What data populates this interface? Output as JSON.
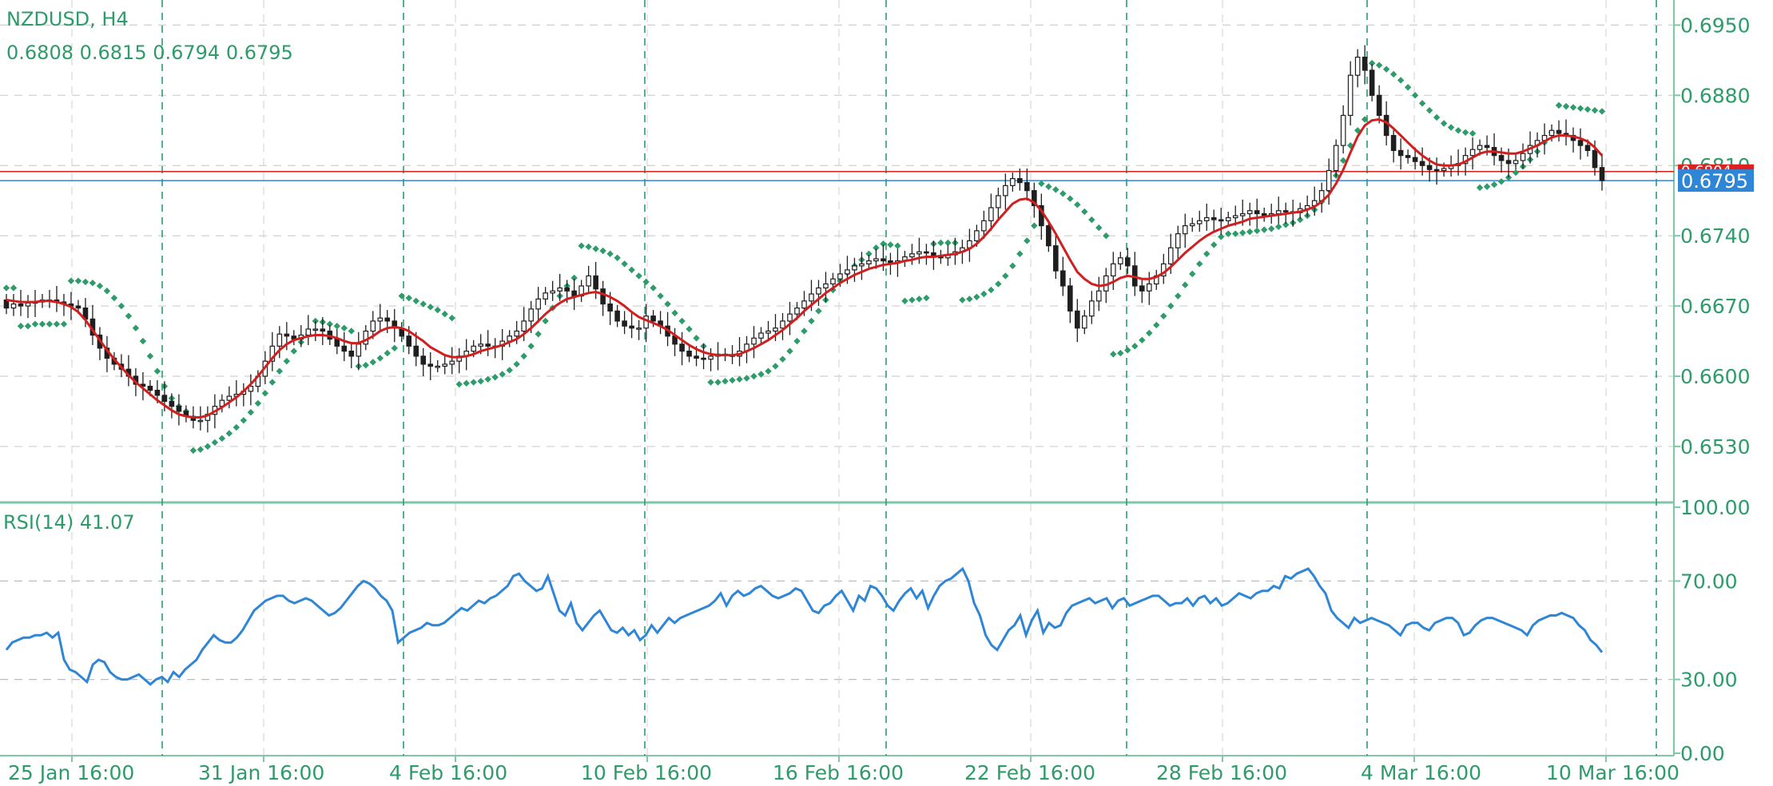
{
  "header": {
    "symbol": "NZDUSD, H4",
    "ohlc": "0.6808 0.6815 0.6794 0.6795",
    "rsi": "RSI(14) 41.07"
  },
  "colors": {
    "accent": "#2e9b6a",
    "candle": "#1f1f1f",
    "ma": "#d11f1f",
    "rsi": "#2f86d6",
    "sar": "#2e9b6a",
    "bid_line": "#2f86d6",
    "ask_line": "#d11f1f"
  },
  "chart_data": [
    {
      "type": "candlestick",
      "title": "NZDUSD, H4",
      "ylim": [
        0.6475,
        0.6975
      ],
      "y_ticks": [
        "0.6950",
        "0.6880",
        "0.6810",
        "0.6740",
        "0.6670",
        "0.6600",
        "0.6530"
      ],
      "x_ticks": [
        "25 Jan 16:00",
        "31 Jan 16:00",
        "4 Feb 16:00",
        "10 Feb 16:00",
        "16 Feb 16:00",
        "22 Feb 16:00",
        "28 Feb 16:00",
        "4 Mar 16:00",
        "10 Mar 16:00"
      ],
      "current_price": "0.6795",
      "ask_price_label": "0.6804",
      "grid": true,
      "close_series": [
        0.6668,
        0.6672,
        0.667,
        0.6673,
        0.6674,
        0.6676,
        0.6676,
        0.6674,
        0.6672,
        0.667,
        0.6668,
        0.6657,
        0.6641,
        0.6628,
        0.6618,
        0.6612,
        0.6607,
        0.66,
        0.6592,
        0.659,
        0.6586,
        0.6581,
        0.6575,
        0.657,
        0.6565,
        0.656,
        0.6556,
        0.6556,
        0.6562,
        0.657,
        0.6576,
        0.658,
        0.6582,
        0.6585,
        0.659,
        0.66,
        0.6615,
        0.663,
        0.6642,
        0.664,
        0.6637,
        0.6641,
        0.6647,
        0.6647,
        0.6645,
        0.6637,
        0.663,
        0.6625,
        0.662,
        0.6632,
        0.6645,
        0.6655,
        0.6658,
        0.6655,
        0.6648,
        0.664,
        0.663,
        0.662,
        0.6612,
        0.661,
        0.661,
        0.6612,
        0.6615,
        0.662,
        0.6625,
        0.663,
        0.6632,
        0.663,
        0.663,
        0.6635,
        0.664,
        0.6645,
        0.6655,
        0.6667,
        0.6677,
        0.6683,
        0.6685,
        0.6688,
        0.6685,
        0.668,
        0.669,
        0.67,
        0.6687,
        0.6672,
        0.6665,
        0.6655,
        0.665,
        0.6648,
        0.6648,
        0.666,
        0.6655,
        0.665,
        0.664,
        0.6632,
        0.6625,
        0.662,
        0.6618,
        0.6617,
        0.662,
        0.6622,
        0.6621,
        0.662,
        0.6625,
        0.6632,
        0.6638,
        0.6643,
        0.6645,
        0.6648,
        0.6655,
        0.6662,
        0.6668,
        0.6675,
        0.6682,
        0.6688,
        0.6692,
        0.6697,
        0.6702,
        0.6706,
        0.671,
        0.6712,
        0.6715,
        0.6717,
        0.6715,
        0.6713,
        0.6715,
        0.6719,
        0.6722,
        0.6724,
        0.6723,
        0.672,
        0.6718,
        0.6721,
        0.6724,
        0.6728,
        0.6735,
        0.6745,
        0.6755,
        0.6768,
        0.678,
        0.679,
        0.6797,
        0.6793,
        0.6785,
        0.677,
        0.675,
        0.673,
        0.6705,
        0.669,
        0.6665,
        0.6648,
        0.666,
        0.6675,
        0.6685,
        0.67,
        0.6712,
        0.6718,
        0.671,
        0.669,
        0.6685,
        0.6692,
        0.67,
        0.6712,
        0.6728,
        0.6742,
        0.675,
        0.6752,
        0.6755,
        0.6758,
        0.6756,
        0.6755,
        0.6758,
        0.676,
        0.6762,
        0.6765,
        0.6762,
        0.676,
        0.6762,
        0.6765,
        0.6764,
        0.6763,
        0.6767,
        0.677,
        0.6775,
        0.6785,
        0.6805,
        0.683,
        0.686,
        0.69,
        0.6918,
        0.6905,
        0.688,
        0.686,
        0.684,
        0.6825,
        0.682,
        0.6818,
        0.6814,
        0.681,
        0.6806,
        0.6805,
        0.6807,
        0.681,
        0.6812,
        0.682,
        0.6826,
        0.683,
        0.6828,
        0.682,
        0.6815,
        0.6812,
        0.6815,
        0.6822,
        0.683,
        0.6835,
        0.684,
        0.6845,
        0.6842,
        0.684,
        0.6835,
        0.683,
        0.6825,
        0.6808,
        0.6795
      ],
      "ma_series": [
        0.6676,
        0.6675,
        0.6674,
        0.6674,
        0.6674,
        0.6675,
        0.6675,
        0.6674,
        0.6672,
        0.6669,
        0.6664,
        0.6656,
        0.6646,
        0.6636,
        0.6626,
        0.6617,
        0.6609,
        0.6601,
        0.6594,
        0.6588,
        0.6582,
        0.6576,
        0.6571,
        0.6566,
        0.6562,
        0.656,
        0.6559,
        0.6559,
        0.6561,
        0.6565,
        0.6569,
        0.6574,
        0.6579,
        0.6585,
        0.6592,
        0.66,
        0.6609,
        0.6618,
        0.6626,
        0.6632,
        0.6636,
        0.6638,
        0.664,
        0.6641,
        0.6641,
        0.664,
        0.6638,
        0.6635,
        0.6633,
        0.6633,
        0.6636,
        0.664,
        0.6645,
        0.6648,
        0.6649,
        0.6648,
        0.6645,
        0.664,
        0.6635,
        0.6629,
        0.6625,
        0.6621,
        0.6619,
        0.6619,
        0.662,
        0.6622,
        0.6625,
        0.6627,
        0.6629,
        0.6631,
        0.6634,
        0.6637,
        0.6642,
        0.6648,
        0.6655,
        0.6662,
        0.6668,
        0.6673,
        0.6677,
        0.6679,
        0.6681,
        0.6683,
        0.6684,
        0.6682,
        0.6679,
        0.6675,
        0.667,
        0.6664,
        0.6659,
        0.6656,
        0.6653,
        0.665,
        0.6646,
        0.6641,
        0.6636,
        0.6631,
        0.6627,
        0.6624,
        0.6622,
        0.6621,
        0.6621,
        0.6621,
        0.6622,
        0.6625,
        0.6628,
        0.6632,
        0.6636,
        0.6641,
        0.6646,
        0.6652,
        0.6658,
        0.6665,
        0.6671,
        0.6677,
        0.6683,
        0.6688,
        0.6693,
        0.6697,
        0.6701,
        0.6704,
        0.6707,
        0.6709,
        0.6711,
        0.6712,
        0.6713,
        0.6715,
        0.6716,
        0.6718,
        0.6719,
        0.6719,
        0.672,
        0.6721,
        0.6722,
        0.6724,
        0.6727,
        0.6732,
        0.6739,
        0.6747,
        0.6756,
        0.6764,
        0.6772,
        0.6776,
        0.6777,
        0.6773,
        0.6765,
        0.6754,
        0.6742,
        0.6729,
        0.6716,
        0.6704,
        0.6697,
        0.6692,
        0.669,
        0.6691,
        0.6694,
        0.6698,
        0.67,
        0.6699,
        0.6697,
        0.6697,
        0.6699,
        0.6703,
        0.6709,
        0.6716,
        0.6723,
        0.6729,
        0.6735,
        0.674,
        0.6744,
        0.6747,
        0.675,
        0.6752,
        0.6754,
        0.6757,
        0.6758,
        0.6759,
        0.676,
        0.6761,
        0.6762,
        0.6763,
        0.6764,
        0.6766,
        0.6769,
        0.6774,
        0.6781,
        0.6792,
        0.6806,
        0.6823,
        0.6839,
        0.685,
        0.6855,
        0.6856,
        0.6853,
        0.6847,
        0.684,
        0.6833,
        0.6826,
        0.682,
        0.6815,
        0.6811,
        0.681,
        0.681,
        0.6811,
        0.6814,
        0.6818,
        0.6822,
        0.6824,
        0.6824,
        0.6823,
        0.6822,
        0.6822,
        0.6824,
        0.6827,
        0.683,
        0.6834,
        0.6838,
        0.684,
        0.684,
        0.6839,
        0.6837,
        0.6834,
        0.6828,
        0.682
      ],
      "sar_series": [
        0.6688,
        0.6688,
        0.665,
        0.665,
        0.6652,
        0.6652,
        0.6652,
        0.6652,
        0.6652,
        0.6695,
        0.6695,
        0.6694,
        0.6693,
        0.669,
        0.6685,
        0.6678,
        0.667,
        0.666,
        0.6648,
        0.6635,
        0.662,
        0.6605,
        0.659,
        0.6578,
        0.657,
        0.6565,
        0.6526,
        0.6527,
        0.653,
        0.6534,
        0.6538,
        0.6543,
        0.6549,
        0.6556,
        0.6564,
        0.6573,
        0.6583,
        0.6594,
        0.6605,
        0.6615,
        0.6625,
        0.6634,
        0.6642,
        0.6655,
        0.6654,
        0.6652,
        0.665,
        0.6648,
        0.6645,
        0.661,
        0.6611,
        0.6614,
        0.6618,
        0.6623,
        0.6628,
        0.668,
        0.6678,
        0.6675,
        0.6672,
        0.6669,
        0.6666,
        0.6662,
        0.6658,
        0.6592,
        0.6593,
        0.6594,
        0.6595,
        0.6597,
        0.6599,
        0.6602,
        0.6606,
        0.6612,
        0.662,
        0.663,
        0.6642,
        0.6655,
        0.6668,
        0.668,
        0.669,
        0.6698,
        0.673,
        0.6729,
        0.6727,
        0.6725,
        0.6722,
        0.6718,
        0.6712,
        0.6706,
        0.67,
        0.6694,
        0.6688,
        0.668,
        0.6672,
        0.6663,
        0.6655,
        0.6647,
        0.6638,
        0.663,
        0.6594,
        0.6594,
        0.6595,
        0.6596,
        0.6597,
        0.6598,
        0.66,
        0.6602,
        0.6605,
        0.661,
        0.6617,
        0.6625,
        0.6635,
        0.6645,
        0.6655,
        0.6665,
        0.6676,
        0.6686,
        0.6695,
        0.6703,
        0.671,
        0.6716,
        0.6722,
        0.6728,
        0.6732,
        0.6731,
        0.673,
        0.6675,
        0.6676,
        0.6677,
        0.6678,
        0.6732,
        0.6733,
        0.6733,
        0.6733,
        0.6676,
        0.6677,
        0.6679,
        0.6682,
        0.6686,
        0.6692,
        0.67,
        0.671,
        0.6722,
        0.6735,
        0.675,
        0.6792,
        0.6789,
        0.6786,
        0.6782,
        0.6777,
        0.6771,
        0.6764,
        0.6756,
        0.6748,
        0.674,
        0.6622,
        0.6623,
        0.6626,
        0.663,
        0.6636,
        0.6643,
        0.6651,
        0.666,
        0.667,
        0.668,
        0.6691,
        0.6702,
        0.6712,
        0.6722,
        0.6731,
        0.6739,
        0.6742,
        0.6742,
        0.6743,
        0.6744,
        0.6745,
        0.6746,
        0.6747,
        0.6749,
        0.6751,
        0.6753,
        0.6756,
        0.676,
        0.6766,
        0.6774,
        0.6786,
        0.68,
        0.6815,
        0.683,
        0.6845,
        0.6856,
        0.6912,
        0.691,
        0.6906,
        0.6901,
        0.6895,
        0.6888,
        0.688,
        0.6872,
        0.6865,
        0.6858,
        0.6852,
        0.6848,
        0.6845,
        0.6843,
        0.6842,
        0.6788,
        0.6789,
        0.6791,
        0.6794,
        0.6798,
        0.6803,
        0.6809,
        0.6816,
        0.6824,
        0.6833,
        0.6843,
        0.687,
        0.6869,
        0.6868,
        0.6867,
        0.6866,
        0.6865,
        0.6864
      ]
    },
    {
      "type": "line",
      "title": "RSI(14) 41.07",
      "ylim": [
        0,
        100
      ],
      "y_ticks": [
        "100.00",
        "70.00",
        "30.00",
        "0.00"
      ],
      "levels": [
        70,
        30
      ],
      "rsi_series": [
        42,
        45,
        46,
        47,
        47,
        48,
        48,
        49,
        47,
        49,
        38,
        34,
        33,
        31,
        29,
        36,
        38,
        37,
        33,
        31,
        30,
        30,
        31,
        32,
        30,
        28,
        30,
        31,
        29,
        33,
        31,
        34,
        36,
        38,
        42,
        45,
        48,
        46,
        45,
        45,
        47,
        50,
        54,
        58,
        60,
        62,
        63,
        64,
        64,
        62,
        61,
        62,
        63,
        62,
        60,
        58,
        56,
        57,
        59,
        62,
        65,
        68,
        70,
        69,
        67,
        64,
        62,
        58,
        45,
        47,
        49,
        50,
        51,
        53,
        52,
        52,
        53,
        55,
        57,
        59,
        58,
        60,
        62,
        61,
        63,
        64,
        66,
        68,
        72,
        73,
        70,
        68,
        66,
        67,
        72,
        65,
        58,
        56,
        61,
        53,
        50,
        53,
        56,
        58,
        54,
        50,
        49,
        51,
        48,
        50,
        46,
        48,
        52,
        49,
        52,
        55,
        53,
        55,
        56,
        57,
        58,
        59,
        60,
        62,
        65,
        60,
        64,
        66,
        64,
        65,
        67,
        68,
        66,
        64,
        63,
        64,
        65,
        67,
        66,
        62,
        58,
        57,
        60,
        61,
        64,
        66,
        62,
        58,
        64,
        62,
        68,
        67,
        64,
        60,
        58,
        62,
        65,
        67,
        63,
        66,
        59,
        64,
        68,
        70,
        71,
        73,
        75,
        70,
        61,
        56,
        48,
        44,
        42,
        46,
        50,
        52,
        56,
        48,
        54,
        58,
        49,
        53,
        51,
        52,
        57,
        60,
        61,
        62,
        63,
        61,
        62,
        63,
        59,
        62,
        63,
        60,
        61,
        62,
        63,
        64,
        64,
        62,
        60,
        61,
        61,
        63,
        60,
        63,
        64,
        61,
        63,
        60,
        61,
        63,
        65,
        64,
        63,
        65,
        66,
        66,
        68,
        67,
        72,
        71,
        73,
        74,
        75,
        72,
        68,
        65,
        58,
        55,
        53,
        51,
        55,
        53,
        54,
        55,
        54,
        53,
        52,
        50,
        48,
        52,
        53,
        53,
        51,
        50,
        53,
        54,
        55,
        55,
        53,
        48,
        49,
        52,
        54,
        55,
        55,
        54,
        53,
        52,
        51,
        50,
        48,
        52,
        54,
        55,
        56,
        56,
        57,
        56,
        55,
        52,
        50,
        46,
        44,
        41
      ],
      "current_value": 41.07
    }
  ]
}
